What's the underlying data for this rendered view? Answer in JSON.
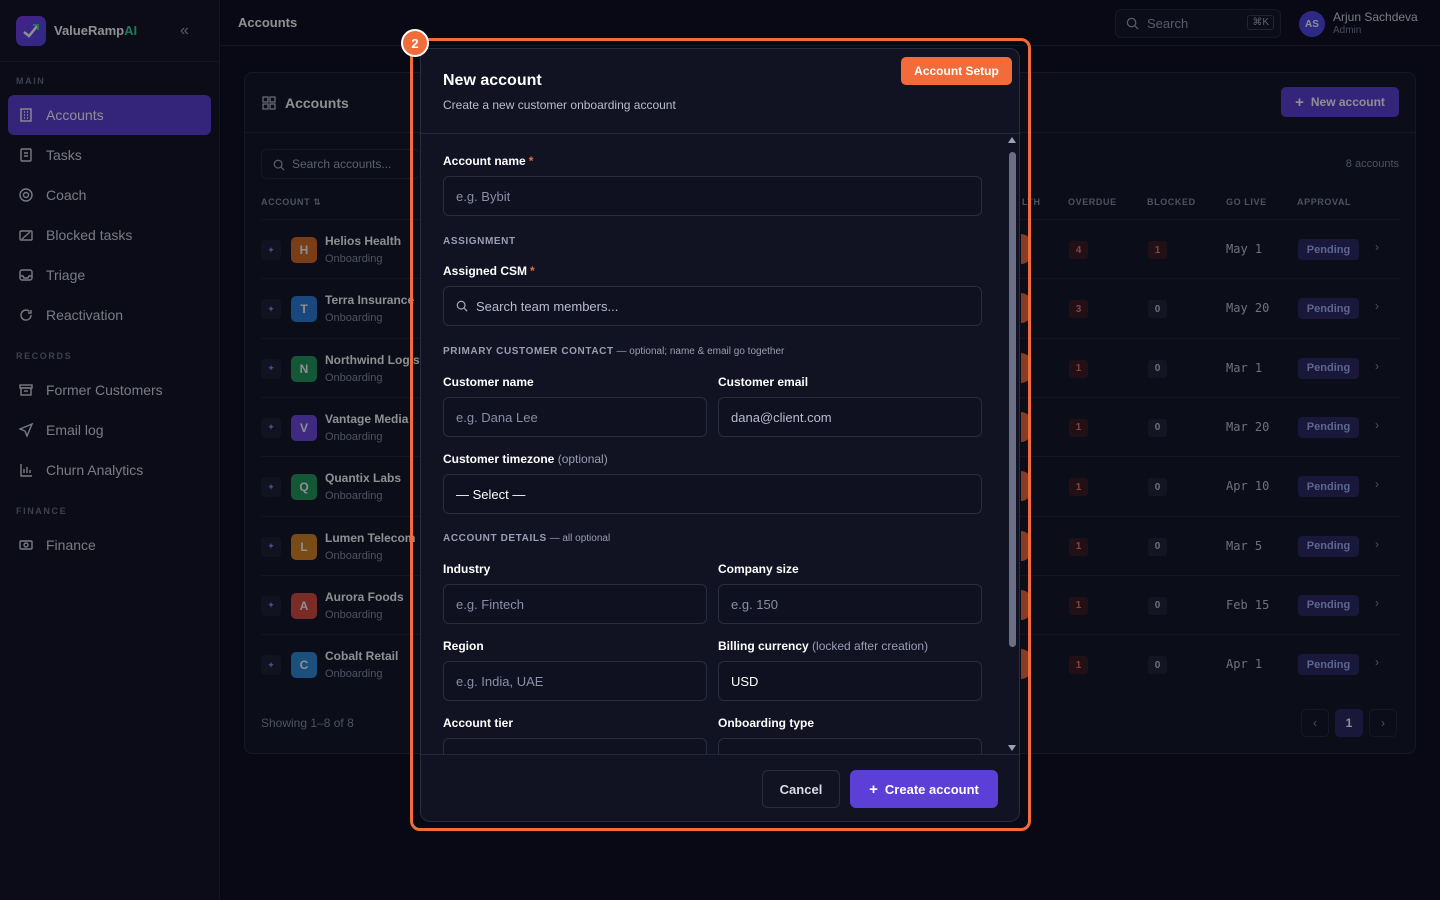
{
  "app": {
    "name": "ValueRamp",
    "name_ai": "AI"
  },
  "sidebar": {
    "sections": [
      {
        "label": "MAIN"
      },
      {
        "label": "RECORDS"
      },
      {
        "label": "FINANCE"
      }
    ],
    "items": [
      {
        "label": "Accounts",
        "icon": "building-icon",
        "active": true
      },
      {
        "label": "Tasks",
        "icon": "clipboard-icon"
      },
      {
        "label": "Coach",
        "icon": "target-icon"
      },
      {
        "label": "Blocked tasks",
        "icon": "blocked-icon"
      },
      {
        "label": "Triage",
        "icon": "inbox-icon"
      },
      {
        "label": "Reactivation",
        "icon": "refresh-icon"
      },
      {
        "label": "Former Customers",
        "icon": "archive-icon"
      },
      {
        "label": "Email log",
        "icon": "send-icon"
      },
      {
        "label": "Churn Analytics",
        "icon": "chart-icon"
      },
      {
        "label": "Finance",
        "icon": "money-icon"
      }
    ]
  },
  "topbar": {
    "title": "Accounts",
    "search_label": "Search",
    "shortcut": "⌘K",
    "user_initials": "AS",
    "user_name": "Arjun Sachdeva",
    "user_role": "Admin"
  },
  "accounts_panel": {
    "title": "Accounts",
    "new_button": "New account",
    "search_placeholder": "Search accounts...",
    "count": "8 accounts",
    "columns": {
      "account": "ACCOUNT",
      "health": "LTH",
      "overdue": "OVERDUE",
      "blocked": "BLOCKED",
      "go_live": "GO LIVE",
      "approval": "APPROVAL"
    },
    "rows": [
      {
        "initial": "H",
        "name": "Helios Health",
        "stage": "Onboarding",
        "overdue": "4",
        "blocked": "1",
        "go_live": "May 1",
        "approval": "Pending",
        "color": "#d96a1f"
      },
      {
        "initial": "T",
        "name": "Terra Insurance",
        "stage": "Onboarding",
        "overdue": "3",
        "blocked": "0",
        "go_live": "May 20",
        "approval": "Pending",
        "color": "#2f7fd8"
      },
      {
        "initial": "N",
        "name": "Northwind Logistics",
        "stage": "Onboarding",
        "overdue": "1",
        "blocked": "0",
        "go_live": "Mar 1",
        "approval": "Pending",
        "color": "#1f9a5a"
      },
      {
        "initial": "V",
        "name": "Vantage Media",
        "stage": "Onboarding",
        "overdue": "1",
        "blocked": "0",
        "go_live": "Mar 20",
        "approval": "Pending",
        "color": "#6d4ae0"
      },
      {
        "initial": "Q",
        "name": "Quantix Labs",
        "stage": "Onboarding",
        "overdue": "1",
        "blocked": "0",
        "go_live": "Apr 10",
        "approval": "Pending",
        "color": "#1f9a5a"
      },
      {
        "initial": "L",
        "name": "Lumen Telecom",
        "stage": "Onboarding",
        "overdue": "1",
        "blocked": "0",
        "go_live": "Mar 5",
        "approval": "Pending",
        "color": "#d9841f"
      },
      {
        "initial": "A",
        "name": "Aurora Foods",
        "stage": "Onboarding",
        "overdue": "1",
        "blocked": "0",
        "go_live": "Feb 15",
        "approval": "Pending",
        "color": "#d94a3a"
      },
      {
        "initial": "C",
        "name": "Cobalt Retail",
        "stage": "Onboarding",
        "overdue": "1",
        "blocked": "0",
        "go_live": "Apr 1",
        "approval": "Pending",
        "color": "#2f8ad8"
      }
    ],
    "showing": "Showing 1–8 of 8",
    "page": "1"
  },
  "step_marker": "2",
  "modal": {
    "title": "New account",
    "subtitle": "Create a new customer onboarding account",
    "tag": "Account Setup",
    "account_name_label": "Account name",
    "account_name_placeholder": "e.g. Bybit",
    "assignment_section": "ASSIGNMENT",
    "csm_label": "Assigned CSM",
    "csm_placeholder": "Search team members...",
    "contact_section": "PRIMARY CUSTOMER CONTACT",
    "contact_hint": " — optional; name & email go together",
    "customer_name_label": "Customer name",
    "customer_name_placeholder": "e.g. Dana Lee",
    "customer_email_label": "Customer email",
    "customer_email_placeholder": "dana@client.com",
    "timezone_label": "Customer timezone",
    "timezone_opt": " (optional)",
    "timezone_value": "— Select —",
    "details_section": "ACCOUNT DETAILS",
    "details_hint": " — all optional",
    "industry_label": "Industry",
    "industry_placeholder": "e.g. Fintech",
    "company_size_label": "Company size",
    "company_size_placeholder": "e.g. 150",
    "region_label": "Region",
    "region_placeholder": "e.g. India, UAE",
    "currency_label": "Billing currency",
    "currency_opt": " (locked after creation)",
    "currency_value": "USD",
    "tier_label": "Account tier",
    "onboarding_type_label": "Onboarding type",
    "cancel_button": "Cancel",
    "create_button": "Create account"
  },
  "colors": {
    "accent": "#5b3fd6",
    "highlight": "#f26b3a",
    "background": "#0b0c1b"
  }
}
